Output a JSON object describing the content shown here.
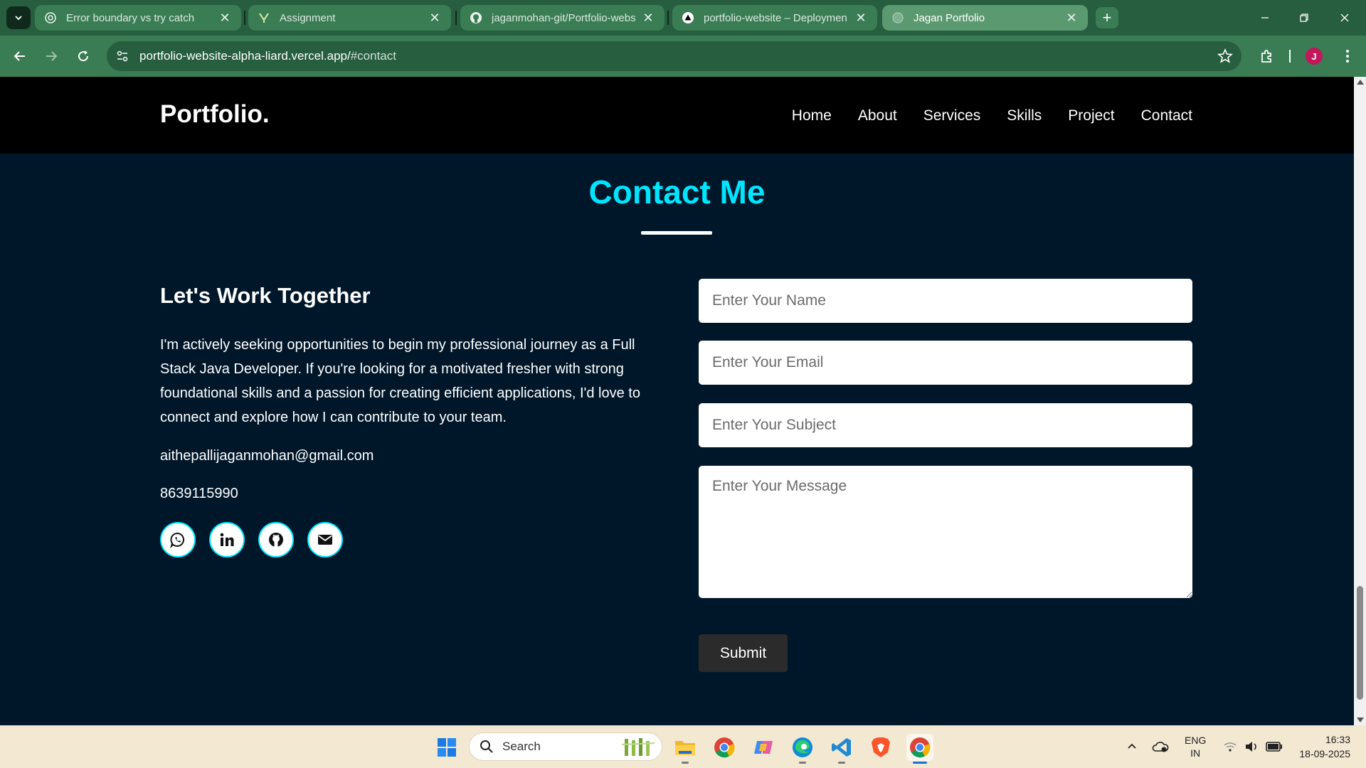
{
  "browser": {
    "tabs": [
      {
        "title": "Error boundary vs try catch",
        "icon": "openai-icon",
        "active": false
      },
      {
        "title": "Assignment",
        "icon": "leaf-favicon-icon",
        "active": false
      },
      {
        "title": "jaganmohan-git/Portfolio-webs",
        "icon": "github-icon",
        "active": false
      },
      {
        "title": "portfolio-website – Deploymen",
        "icon": "vercel-icon",
        "active": false
      },
      {
        "title": "Jagan Portfolio",
        "icon": "globe-icon",
        "active": true
      }
    ],
    "url_main": "portfolio-website-alpha-liard.vercel.app/",
    "url_hash": "#contact",
    "profile_initial": "J"
  },
  "site": {
    "logo": "Portfolio.",
    "nav": [
      "Home",
      "About",
      "Services",
      "Skills",
      "Project",
      "Contact"
    ],
    "section_title": "Contact Me",
    "heading": "Let's Work Together",
    "description": "I'm actively seeking opportunities to begin my professional journey as a Full Stack Java Developer. If you're looking for a motivated fresher with strong foundational skills and a passion for creating efficient applications, I'd love to connect and explore how I can contribute to your team.",
    "email": "aithepallijaganmohan@gmail.com",
    "phone": "8639115990",
    "socials": [
      "whatsapp-icon",
      "linkedin-icon",
      "github-icon",
      "mail-icon"
    ],
    "form": {
      "name_placeholder": "Enter Your Name",
      "email_placeholder": "Enter Your Email",
      "subject_placeholder": "Enter Your Subject",
      "message_placeholder": "Enter Your Message",
      "submit_label": "Submit"
    },
    "colors": {
      "accent": "#00e5ff",
      "background": "#00172a",
      "header": "#000000",
      "submit": "#2b2b2b"
    }
  },
  "taskbar": {
    "search_label": "Search",
    "language_line1": "ENG",
    "language_line2": "IN",
    "time": "16:33",
    "date": "18-09-2025"
  }
}
